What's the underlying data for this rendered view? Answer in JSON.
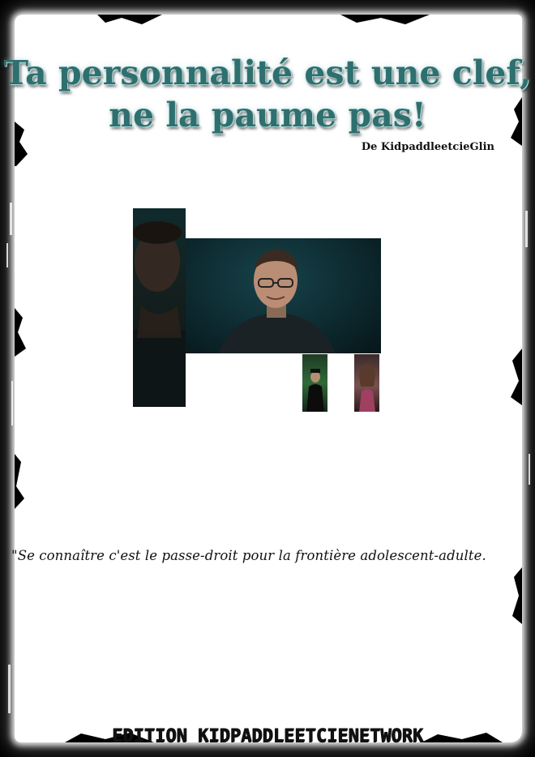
{
  "poster": {
    "title_line1": "Ta personnalité est une clef,",
    "title_line2": "ne la paume pas!",
    "author": "De KidpaddleetcieGlin",
    "quote": "\"Se connaître c'est le passe-droit pour la frontière adolescent-adulte.",
    "footer": "EDITION KIDPADDLEETCIENETWORK"
  },
  "colors": {
    "background": "#000000",
    "sheet": "#ffffff",
    "title": "#2e6f6f",
    "text": "#111111"
  }
}
